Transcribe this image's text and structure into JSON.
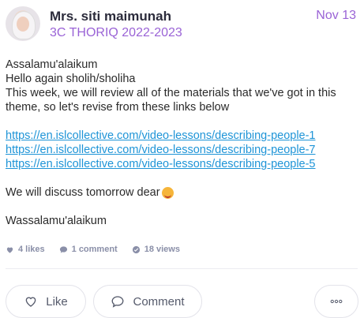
{
  "post": {
    "author": "Mrs. siti maimunah",
    "course": "3C THORIQ 2022-2023",
    "date": "Nov 13",
    "greeting": "Assalamu'alaikum",
    "hello": "Hello again sholih/sholiha",
    "message": "This week, we will review all of the materials that we've got in this theme, so let's revise from these links below",
    "links": [
      "https://en.islcollective.com/video-lessons/describing-people-1",
      "https://en.islcollective.com/video-lessons/describing-people-7",
      "https://en.islcollective.com/video-lessons/describing-people-5"
    ],
    "discuss": "We will discuss tomorrow dear",
    "closing": "Wassalamu'alaikum"
  },
  "stats": {
    "likes": "4 likes",
    "comments": "1 comment",
    "views": "18 views"
  },
  "actions": {
    "like_label": "Like",
    "comment_label": "Comment"
  },
  "icons": {
    "likes": "heart-icon",
    "comments": "speech-bubble-icon",
    "views": "eye-icon",
    "more": "ellipsis-icon"
  },
  "colors": {
    "accent": "#9a63d6",
    "link": "#1e94d7",
    "muted": "#8a8fa8"
  }
}
